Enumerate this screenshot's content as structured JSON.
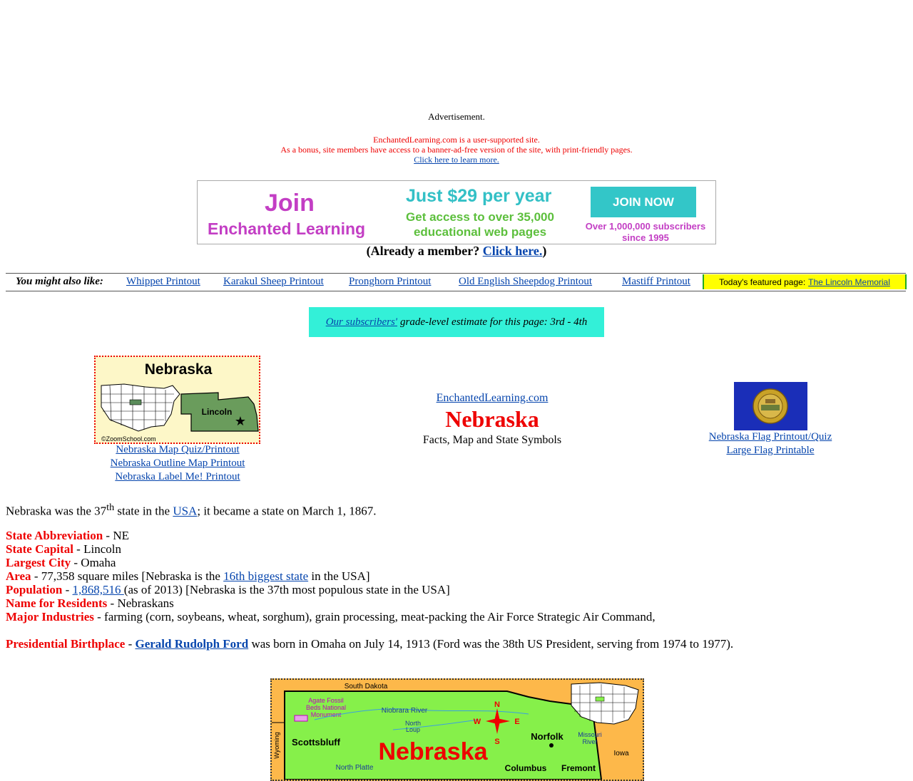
{
  "ad": {
    "label": "Advertisement.",
    "support_line1": "EnchantedLearning.com is a user-supported site.",
    "support_line2": "As a bonus, site members have access to a banner-ad-free version of the site, with print-friendly pages.",
    "learn_more": "Click here to learn more."
  },
  "banner": {
    "join": "Join",
    "enchanted": "Enchanted Learning",
    "price": "Just $29 per year",
    "access": "Get access to over 35,000 educational web pages",
    "button": "JOIN NOW",
    "subscribers": "Over 1,000,000 subscribers since 1995"
  },
  "member": {
    "prefix": "(Already a member? ",
    "link": "Click here.",
    "suffix": ")"
  },
  "related": {
    "heading": "You might also like:",
    "links": [
      "Whippet Printout",
      "Karakul Sheep Printout",
      "Pronghorn Printout",
      "Old English Sheepdog Printout",
      "Mastiff Printout"
    ],
    "featured_label": "Today's featured page:",
    "featured_link": "The Lincoln Memorial"
  },
  "grade": {
    "link": "Our subscribers'",
    "text": "grade-level estimate for this page: 3rd - 4th"
  },
  "thumb": {
    "title": "Nebraska",
    "city": "Lincoln",
    "credit": "©ZoomSchool.com",
    "links": [
      "Nebraska Map Quiz/Printout",
      "Nebraska Outline Map Printout",
      "Nebraska Label Me! Printout"
    ]
  },
  "title": {
    "site": "EnchantedLearning.com",
    "state": "Nebraska",
    "subtitle": "Facts, Map and State Symbols"
  },
  "flag": {
    "links": [
      "Nebraska Flag Printout/Quiz",
      "Large Flag Printable"
    ]
  },
  "intro": {
    "before": "Nebraska was the 37",
    "sup": "th",
    "mid": " state in the ",
    "link": "USA",
    "after": "; it became a state on March 1, 1867."
  },
  "facts": {
    "abbr_label": "State Abbreviation",
    "abbr_value": " - NE",
    "capital_label": "State Capital",
    "capital_value": " - Lincoln",
    "city_label": "Largest City",
    "city_value": " - Omaha",
    "area_label": "Area",
    "area_value": " - 77,358 square miles [Nebraska is the ",
    "area_link": "16th biggest state",
    "area_after": " in the USA]",
    "pop_label": "Population",
    "pop_dash": " - ",
    "pop_link": "1,868,516 ",
    "pop_after": "(as of 2013) [Nebraska is the 37th most populous state in the USA]",
    "residents_label": "Name for Residents",
    "residents_value": " - Nebraskans",
    "industries_label": "Major Industries",
    "industries_value": " - farming (corn, soybeans, wheat, sorghum), grain processing, meat-packing the Air Force Strategic Air Command,"
  },
  "birthplace": {
    "label": "Presidential Birthplace",
    "dash": " - ",
    "link": "Gerald Rudolph Ford",
    "after": " was born in Omaha on July 14, 1913 (Ford was the 38th US President, serving from 1974 to 1977)."
  },
  "map": {
    "south_dakota": "South Dakota",
    "agate1": "Agate Fossil",
    "agate2": "Beds National",
    "agate3": "Monument",
    "niobrara": "Niobrara River",
    "north_loup1": "North",
    "north_loup2": "Loup",
    "wyoming": "Wyoming",
    "scottsbluff": "Scottsbluff",
    "state": "Nebraska",
    "norfolk": "Norfolk",
    "missouri1": "Missouri",
    "missouri2": "River",
    "iowa": "Iowa",
    "north_platte": "North Platte",
    "columbus": "Columbus",
    "fremont": "Fremont",
    "compass_n": "N",
    "compass_s": "S",
    "compass_e": "E",
    "compass_w": "W"
  }
}
